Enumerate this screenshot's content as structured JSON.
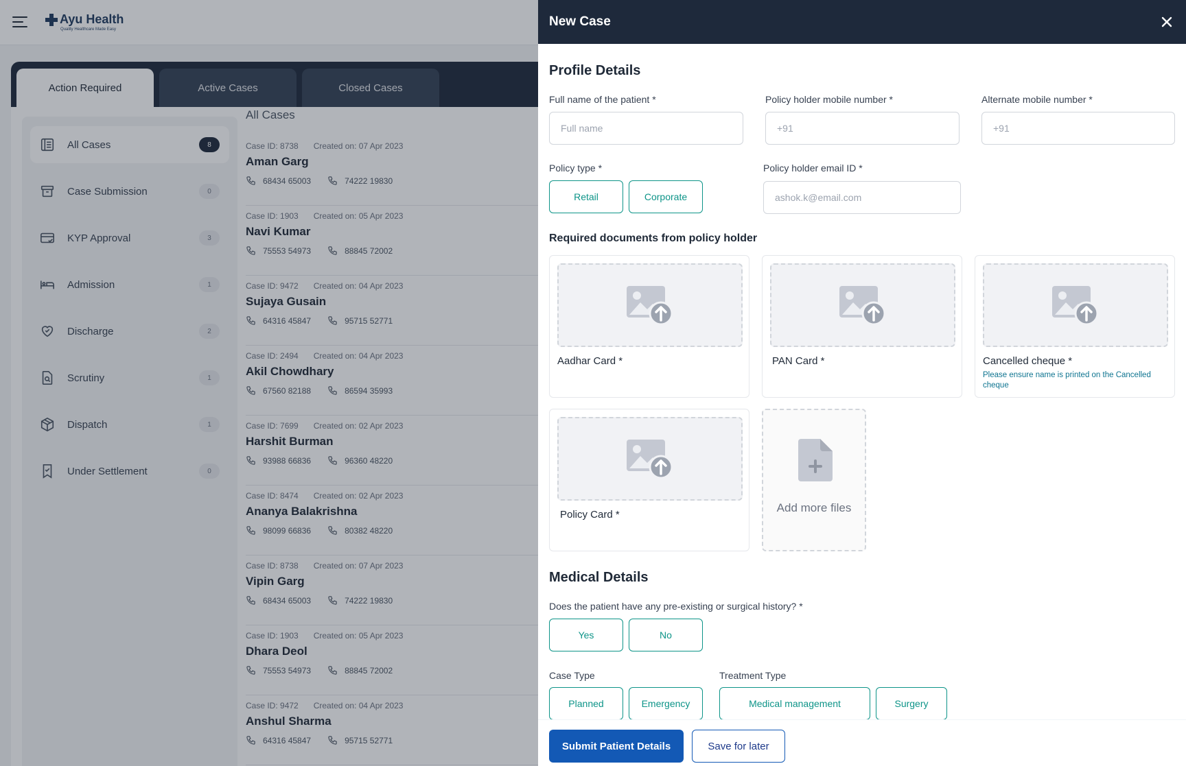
{
  "app": {
    "brand": "Ayu Health",
    "tagline": "Quality Healthcare Made Easy",
    "tabs": [
      "Action Required",
      "Active Cases",
      "Closed Cases"
    ]
  },
  "sidebar": {
    "items": [
      {
        "label": "All Cases",
        "count": "8",
        "icon": "list-icon"
      },
      {
        "label": "Case Submission",
        "count": "0",
        "icon": "archive-icon"
      },
      {
        "label": "KYP Approval",
        "count": "3",
        "icon": "card-check-icon"
      },
      {
        "label": "Admission",
        "count": "1",
        "icon": "bed-icon"
      },
      {
        "label": "Discharge",
        "count": "2",
        "icon": "heart-icon"
      },
      {
        "label": "Scrutiny",
        "count": "1",
        "icon": "document-search-icon"
      },
      {
        "label": "Dispatch",
        "count": "1",
        "icon": "package-icon"
      },
      {
        "label": "Under Settlement",
        "count": "0",
        "icon": "bookmark-check-icon"
      }
    ]
  },
  "cases": {
    "title": "All Cases",
    "rows": [
      {
        "id": "Case ID: 8738",
        "created": "Created on: 07 Apr 2023",
        "name": "Aman Garg",
        "phone1": "68434 65003",
        "phone2": "74222 19830"
      },
      {
        "id": "Case ID: 1903",
        "created": "Created on: 05 Apr 2023",
        "name": "Navi Kumar",
        "phone1": "75553 54973",
        "phone2": "88845 72002"
      },
      {
        "id": "Case ID: 9472",
        "created": "Created on: 04 Apr 2023",
        "name": "Sujaya Gusain",
        "phone1": "64316 45847",
        "phone2": "95715 52771"
      },
      {
        "id": "Case ID: 2494",
        "created": "Created on: 04 Apr 2023",
        "name": "Akil Chowdhary",
        "phone1": "67560 82188",
        "phone2": "86594 35993"
      },
      {
        "id": "Case ID: 7699",
        "created": "Created on: 02 Apr 2023",
        "name": "Harshit Burman",
        "phone1": "93988 66836",
        "phone2": "96360 48220"
      },
      {
        "id": "Case ID: 8474",
        "created": "Created on: 02 Apr 2023",
        "name": "Ananya Balakrishna",
        "phone1": "98099 66836",
        "phone2": "80382 48220"
      },
      {
        "id": "Case ID: 8738",
        "created": "Created on: 07 Apr 2023",
        "name": "Vipin Garg",
        "phone1": "68434 65003",
        "phone2": "74222 19830"
      },
      {
        "id": "Case ID: 1903",
        "created": "Created on: 05 Apr 2023",
        "name": "Dhara Deol",
        "phone1": "75553 54973",
        "phone2": "88845 72002"
      },
      {
        "id": "Case ID: 9472",
        "created": "Created on: 04 Apr 2023",
        "name": "Anshul Sharma",
        "phone1": "64316 45847",
        "phone2": "95715 52771"
      }
    ]
  },
  "drawer": {
    "title": "New Case",
    "profile": {
      "heading": "Profile Details",
      "full_name_label": "Full name of the patient *",
      "full_name_placeholder": "Full name",
      "mobile_label": "Policy holder mobile number *",
      "mobile_placeholder": "+91",
      "alt_mobile_label": "Alternate mobile number *",
      "alt_mobile_placeholder": "+91",
      "policy_type_label": "Policy type *",
      "policy_type_options": [
        "Retail",
        "Corporate"
      ],
      "email_label": "Policy holder email ID *",
      "email_placeholder": "ashok.k@email.com"
    },
    "documents": {
      "heading": "Required documents from policy holder",
      "items": [
        {
          "label": "Aadhar Card  *",
          "note": ""
        },
        {
          "label": "PAN Card  *",
          "note": ""
        },
        {
          "label": "Cancelled cheque  *",
          "note": "Please ensure name is printed on the Cancelled cheque"
        },
        {
          "label": "Policy Card  *",
          "note": ""
        }
      ],
      "add_more_label": "Add more files"
    },
    "medical": {
      "heading": "Medical Details",
      "history_question": "Does the patient have any pre-existing or surgical history? *",
      "history_options": [
        "Yes",
        "No"
      ],
      "case_type_label": "Case Type",
      "case_type_options": [
        "Planned",
        "Emergency"
      ],
      "treatment_type_label": "Treatment Type",
      "treatment_type_options": [
        "Medical management",
        "Surgery"
      ]
    },
    "footer": {
      "submit_label": "Submit Patient Details",
      "save_label": "Save for later"
    }
  },
  "colors": {
    "header_bg": "#1e293b",
    "accent_teal": "#0d9488",
    "primary_blue": "#1359b5",
    "note_text": "#0e7490"
  }
}
